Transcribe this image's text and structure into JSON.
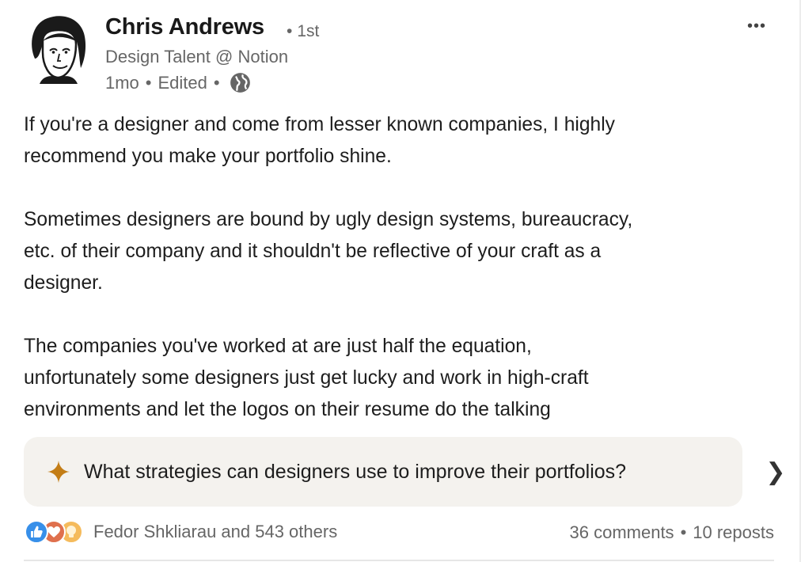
{
  "author": {
    "name": "Chris Andrews",
    "degree": "1st",
    "headline": "Design Talent @ Notion",
    "time": "1mo",
    "edited": "Edited",
    "visibility_icon": "globe-icon"
  },
  "menu": {
    "more_icon": "ellipsis-icon",
    "more_label": "•••"
  },
  "post": {
    "text": "If you're a designer and come from lesser known companies, I highly\nrecommend you make your portfolio shine.\n\nSometimes designers are bound by ugly design systems, bureaucracy,\netc. of their company and it shouldn't be reflective of your craft as a\ndesigner.\n\nThe companies you've worked at are just half the equation,\nunfortunately some designers just get lucky and work in high-craft\nenvironments and let the logos on their resume do the talking"
  },
  "ai_prompt": {
    "icon": "sparkle-icon",
    "text": "What strategies can designers use to improve their portfolios?",
    "next_icon": "chevron-right-icon",
    "next_label": "❯"
  },
  "social": {
    "reaction_icons": [
      "like-icon",
      "love-icon",
      "insightful-icon"
    ],
    "reactions_text": "Fedor Shkliarau and 543 others",
    "comments": "36 comments",
    "reposts": "10 reposts",
    "separator": "•"
  },
  "colors": {
    "text_primary": "#1d1d1d",
    "text_secondary": "#666666",
    "prompt_bg": "#f4f2ee",
    "sparkle": "#c37d16",
    "like_blue": "#378fe9",
    "love_red": "#df704d",
    "insight_yellow": "#f5bb5c"
  }
}
